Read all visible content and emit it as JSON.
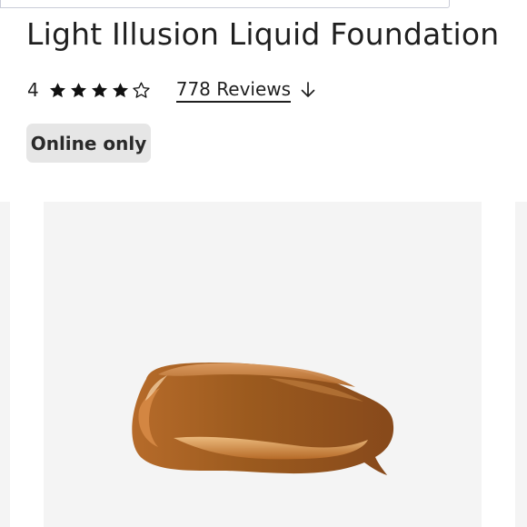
{
  "product": {
    "title": "Light Illusion Liquid Foundation",
    "rating_value": "4",
    "stars": {
      "filled": 4,
      "total": 5
    },
    "reviews_label": "778 Reviews",
    "badge": "Online only"
  },
  "gallery": {
    "main_image_subject": "foundation-swatch"
  },
  "colors": {
    "text": "#1f1f1f",
    "badge_bg": "#e6e6e6",
    "image_bg": "#f4f4f4",
    "swatch_base": "#9b5a1e",
    "swatch_highlight": "#d08a49"
  }
}
